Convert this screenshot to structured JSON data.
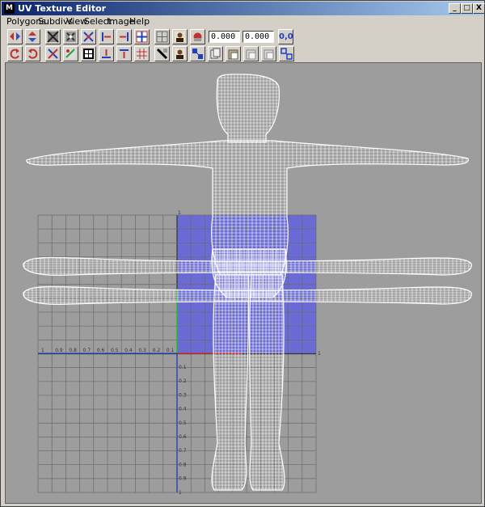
{
  "window": {
    "title": "UV Texture Editor",
    "app_icon": "M",
    "controls": {
      "minimize": "_",
      "maximize": "□",
      "close": "X"
    }
  },
  "menu": {
    "items": [
      {
        "label": "Polygons"
      },
      {
        "label": "Subdivs"
      },
      {
        "label": "View"
      },
      {
        "label": "Select"
      },
      {
        "label": "Image"
      },
      {
        "label": "Help"
      }
    ]
  },
  "toolbar": {
    "u_value": "0.000",
    "v_value": "0.000",
    "uv_coord_label": "0,0",
    "row1_icons": [
      "flip-u-icon",
      "flip-v-icon",
      "cycle-uvs-icon",
      "move-sew-icon",
      "unfold-icon",
      "align-left-icon",
      "align-right-icon",
      "grid-uv-icon",
      "image-grid-icon",
      "show-image-icon",
      "texture-filter-icon"
    ],
    "row2_icons": [
      "rotate-ccw-icon",
      "rotate-cw-icon",
      "cut-uvs-icon",
      "sew-uvs-icon",
      "layout-uvs-icon",
      "align-bottom-icon",
      "align-top-icon",
      "relax-icon",
      "isolate-icon",
      "dim-image-icon",
      "snapshot-icon",
      "copy-uvs-icon",
      "paste-uvs-icon",
      "paste-u-icon",
      "paste-v-icon",
      "uv-sets-icon"
    ]
  },
  "viewport": {
    "colors": {
      "background": "#9d9d9d",
      "uv_tile": "#6b6bd6",
      "grid": "#6a6a6a",
      "wireframe": "#ffffff",
      "u_axis": "#2fbf2f",
      "v_axis": "#d03030"
    },
    "axis_labels_top": [
      "1",
      "0.9",
      "0.8",
      "0.7",
      "0.6",
      "0.5",
      "0.4",
      "0.3",
      "0.2",
      "0.1"
    ],
    "axis_labels_side": [
      "0.1",
      "0.2",
      "0.3",
      "0.4",
      "0.5",
      "0.6",
      "0.7",
      "0.8",
      "0.9",
      "1"
    ],
    "top_marker": "1",
    "right_marker": "1"
  }
}
